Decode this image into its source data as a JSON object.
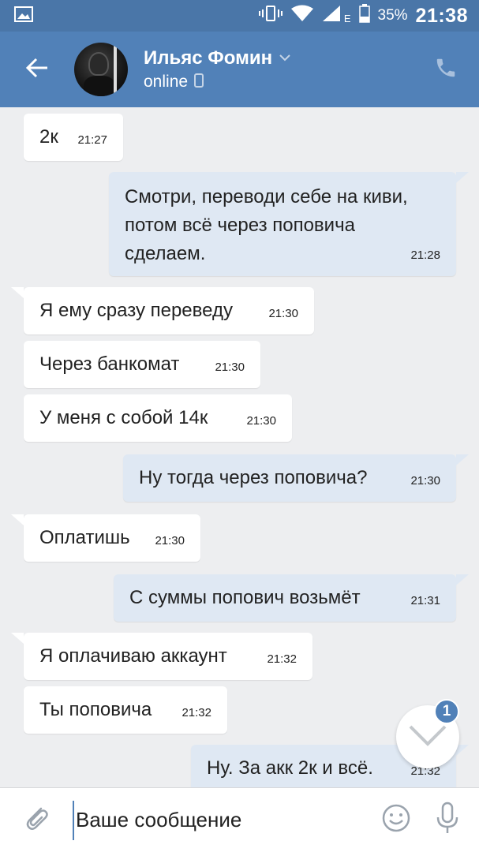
{
  "status_bar": {
    "battery_percent": "35%",
    "network_type": "E",
    "time": "21:38"
  },
  "header": {
    "contact_name": "Ильяс Фомин",
    "contact_status": "online"
  },
  "messages": [
    {
      "dir": "in",
      "text": "2к",
      "time": "21:27"
    },
    {
      "dir": "out",
      "text": "Смотри, переводи себе на киви,\nпотом всё через поповича\nсделаем.",
      "time": "21:28"
    },
    {
      "dir": "in",
      "text": "Я ему сразу переведу",
      "time": "21:30"
    },
    {
      "dir": "in",
      "text": "Через банкомат",
      "time": "21:30"
    },
    {
      "dir": "in",
      "text": "У меня с собой 14к",
      "time": "21:30"
    },
    {
      "dir": "out",
      "text": "Ну тогда через поповича?",
      "time": "21:30"
    },
    {
      "dir": "in",
      "text": "Оплатишь",
      "time": "21:30"
    },
    {
      "dir": "out",
      "text": "С суммы попович возьмёт",
      "time": "21:31"
    },
    {
      "dir": "in",
      "text": "Я оплачиваю аккаунт",
      "time": "21:32"
    },
    {
      "dir": "in",
      "text": "Ты поповича",
      "time": "21:32"
    },
    {
      "dir": "out",
      "text": "Ну. За акк 2к и всё.",
      "time": "21:32"
    }
  ],
  "scroll_down_badge": "1",
  "composer": {
    "placeholder": "Ваше сообщение",
    "value": ""
  },
  "colors": {
    "header_bg": "#5181b8",
    "status_bar_bg": "#4a76a8",
    "chat_bg": "#edeef0",
    "incoming_bubble": "#ffffff",
    "outgoing_bubble": "#dfe8f3",
    "accent": "#5181b8"
  },
  "icons": {
    "status": [
      "gallery-icon",
      "vibrate-icon",
      "wifi-icon",
      "signal-icon",
      "battery-icon"
    ],
    "header": [
      "back-arrow-icon",
      "chevron-down-icon",
      "mobile-device-icon",
      "phone-icon"
    ],
    "composer": [
      "paperclip-icon",
      "emoji-icon",
      "microphone-icon"
    ],
    "fab": "chevron-down-icon"
  }
}
